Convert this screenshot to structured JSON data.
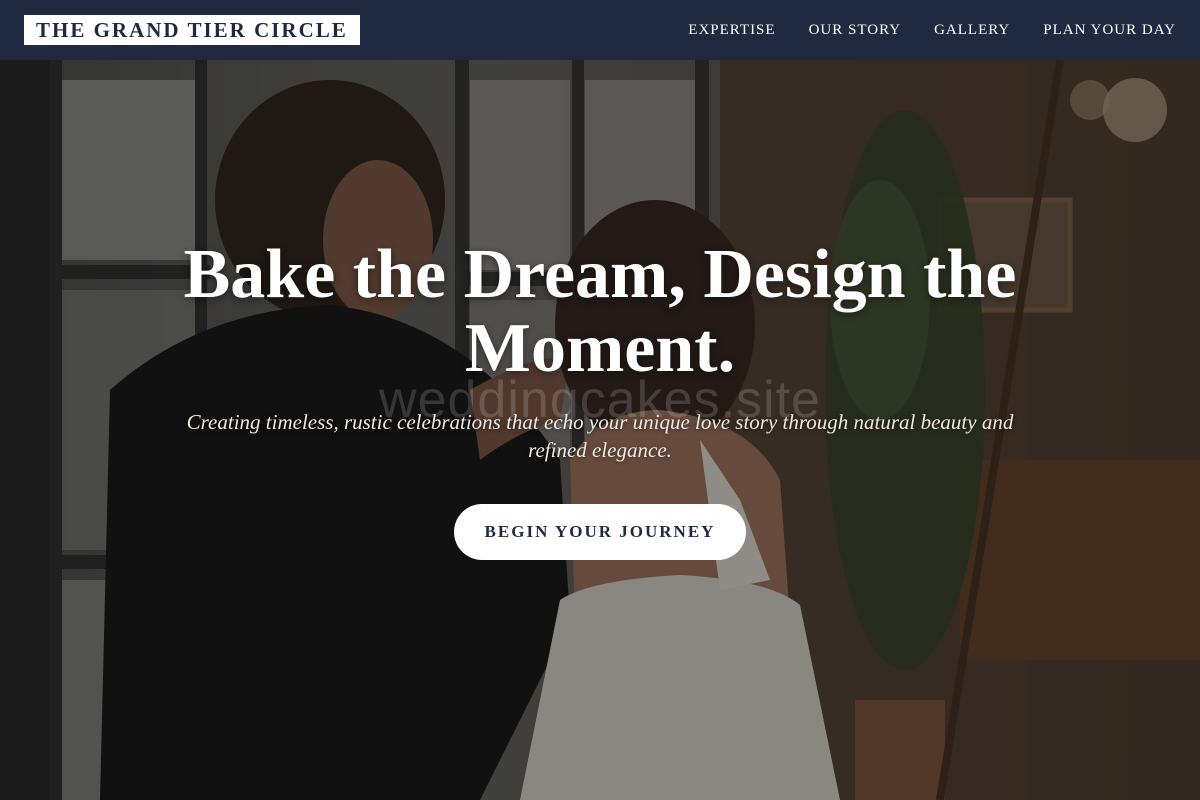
{
  "header": {
    "logo_text": "THE GRAND TIER CIRCLE",
    "nav": [
      {
        "label": "EXPERTISE"
      },
      {
        "label": "OUR STORY"
      },
      {
        "label": "GALLERY"
      },
      {
        "label": "PLAN YOUR DAY"
      }
    ]
  },
  "hero": {
    "title": "Bake the Dream, Design the Moment.",
    "subtitle": "Creating timeless, rustic celebrations that echo your unique love story through natural beauty and refined elegance.",
    "cta_label": "BEGIN YOUR JOURNEY",
    "watermark": "weddingcakes.site"
  },
  "colors": {
    "header_bg": "#1f2a40",
    "logo_bg": "#ffffff",
    "cta_bg": "#ffffff",
    "cta_text": "#1f2a40",
    "text_light": "#ffffff"
  }
}
